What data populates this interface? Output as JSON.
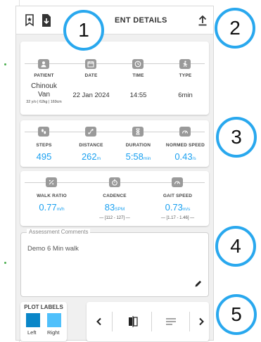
{
  "header": {
    "title": "ENT DETAILS"
  },
  "summary": {
    "patient": {
      "label": "PATIENT",
      "name_line1": "Chinouk",
      "name_line2": "Van",
      "info": "32 y/o | 62kg | 169cm"
    },
    "date": {
      "label": "DATE",
      "value": "22 Jan 2024"
    },
    "time": {
      "label": "TIME",
      "value": "14:55"
    },
    "type": {
      "label": "TYPE",
      "value": "6min"
    }
  },
  "metrics": {
    "steps": {
      "label": "STEPS",
      "value": "495",
      "unit": ""
    },
    "distance": {
      "label": "DISTANCE",
      "value": "262",
      "unit": "m"
    },
    "duration": {
      "label": "DURATION",
      "value": "5:58",
      "unit": "min"
    },
    "normed_speed": {
      "label": "NORMED SPEED",
      "value": "0.43",
      "unit": "/s"
    },
    "walk_ratio": {
      "label": "WALK RATIO",
      "value": "0.77",
      "unit": "m/h"
    },
    "cadence": {
      "label": "CADENCE",
      "value": "83",
      "unit": "SPM",
      "range": "[112 - 127]"
    },
    "gait_speed": {
      "label": "GAIT SPEED",
      "value": "0.73",
      "unit": "m/s",
      "range": "[1.17 - 1.46]"
    }
  },
  "comments": {
    "legend": "Assessment Comments",
    "text": "Demo 6 Min walk"
  },
  "plot_labels": {
    "title": "PLOT LABELS",
    "left": "Left",
    "right": "Right",
    "left_color": "#0a86c8",
    "right_color": "#4fc0fb"
  },
  "callouts": [
    "1",
    "2",
    "3",
    "4",
    "5"
  ],
  "colors": {
    "accent": "#1aa0f0",
    "callout_ring": "#29a8ee"
  }
}
